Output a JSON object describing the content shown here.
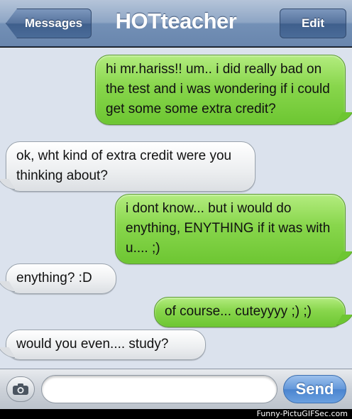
{
  "navbar": {
    "back_label": "Messages",
    "title": "HOTteacher",
    "edit_label": "Edit"
  },
  "messages": [
    {
      "side": "out",
      "text": "hi mr.hariss!! um.. i did really bad on the test and i was wondering if i could get some some extra credit?"
    },
    {
      "side": "in",
      "text": "ok, wht kind of extra credit were you thinking about?"
    },
    {
      "side": "out",
      "text": "i dont know... but i would do enything, ENYTHING if it was with u.... ;)"
    },
    {
      "side": "in",
      "text": "enything? :D"
    },
    {
      "side": "out",
      "text": "of course... cuteyyyy ;) ;)"
    },
    {
      "side": "in",
      "text": "would you even.... study?"
    }
  ],
  "compose": {
    "input_value": "",
    "send_label": "Send",
    "camera_icon": "camera-icon"
  },
  "watermark": "Funny-PictuGIFSec.com",
  "colors": {
    "navbar": "#7390b6",
    "thread_bg": "#dbe2ed",
    "outgoing_bubble": "#88d64c",
    "incoming_bubble": "#eceef0",
    "send_button": "#4a84cf"
  }
}
